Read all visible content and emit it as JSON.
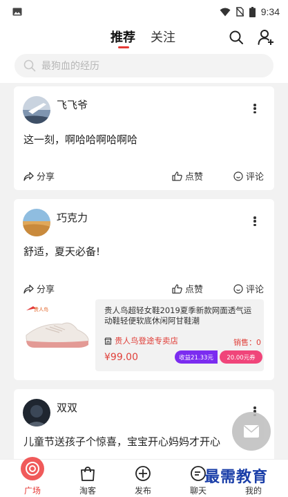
{
  "status_bar": {
    "time": "9:34"
  },
  "header": {
    "tabs": [
      {
        "label": "推荐",
        "active": true
      },
      {
        "label": "关注",
        "active": false
      }
    ]
  },
  "search": {
    "placeholder": "最狗血的经历"
  },
  "posts": [
    {
      "username": "飞飞爷",
      "text": "这一刻，啊哈哈啊哈啊哈",
      "actions": {
        "share": "分享",
        "like": "点赞",
        "comment": "评论"
      }
    },
    {
      "username": "巧克力",
      "text": "舒适，夏天必备!",
      "actions": {
        "share": "分享",
        "like": "点赞",
        "comment": "评论"
      },
      "product": {
        "brand_logo_text": "贵人鸟",
        "title": "贵人鸟超轻女鞋2019夏季新款网面透气运动鞋轻便软底休闲阿甘鞋潮",
        "shop": "贵人鸟登途专卖店",
        "sales": "销售：0",
        "price": "¥99.00",
        "earn": "收益21.33元",
        "coupon": "20.00元券"
      }
    },
    {
      "username": "双双",
      "text": "儿童节送孩子个惊喜，宝宝开心妈妈才开心"
    }
  ],
  "bottom_nav": [
    {
      "label": "广场",
      "icon": "camera-icon",
      "active": true
    },
    {
      "label": "淘客",
      "icon": "bag-icon",
      "active": false
    },
    {
      "label": "发布",
      "icon": "plus-circle-icon",
      "active": false
    },
    {
      "label": "聊天",
      "icon": "chat-icon",
      "active": false
    },
    {
      "label": "我的",
      "icon": "user-icon",
      "active": false
    }
  ],
  "watermark": "最需教育",
  "colors": {
    "accent": "#e53935",
    "earn": "#7b2cf0",
    "coupon": "#f0457a"
  }
}
